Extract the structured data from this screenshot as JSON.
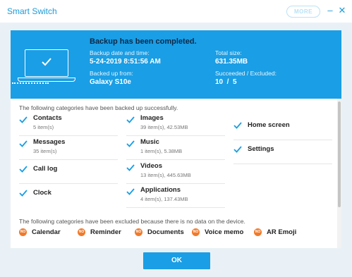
{
  "window": {
    "title": "Smart Switch",
    "more_label": "MORE",
    "minimize_glyph": "–",
    "close_glyph": "✕"
  },
  "banner": {
    "heading": "Backup has been completed.",
    "date_label": "Backup date and time:",
    "date_value": "5-24-2019 8:51:56 AM",
    "device_label": "Backed up from:",
    "device_value": "Galaxy S10e",
    "size_label": "Total size:",
    "size_value": "631.35MB",
    "result_label": "Succeeded / Excluded:",
    "result_value": "10  /  5",
    "icon": "laptop-check-icon"
  },
  "backed_up": {
    "intro": "The following categories have been backed up successfully.",
    "items": [
      {
        "name": "Contacts",
        "detail": "5 item(s)"
      },
      {
        "name": "Messages",
        "detail": "35 item(s)"
      },
      {
        "name": "Call log",
        "detail": ""
      },
      {
        "name": "Clock",
        "detail": ""
      },
      {
        "name": "Images",
        "detail": "39 item(s), 42.53MB"
      },
      {
        "name": "Music",
        "detail": "1 item(s), 5.38MB"
      },
      {
        "name": "Videos",
        "detail": "13 item(s), 445.63MB"
      },
      {
        "name": "Applications",
        "detail": "4 item(s), 137.43MB"
      },
      {
        "name": "Home screen",
        "detail": ""
      },
      {
        "name": "Settings",
        "detail": ""
      }
    ]
  },
  "excluded": {
    "intro": "The following categories have been excluded because there is no data on the device.",
    "badge": "NO",
    "items": [
      "Calendar",
      "Reminder",
      "Documents",
      "Voice memo",
      "AR Emoji"
    ]
  },
  "footer": {
    "ok_label": "OK"
  },
  "colors": {
    "accent": "#1a9ee5",
    "heading_dark": "#0b2a4a",
    "excluded_badge": "#f07a2a",
    "background": "#eaf1f6"
  }
}
